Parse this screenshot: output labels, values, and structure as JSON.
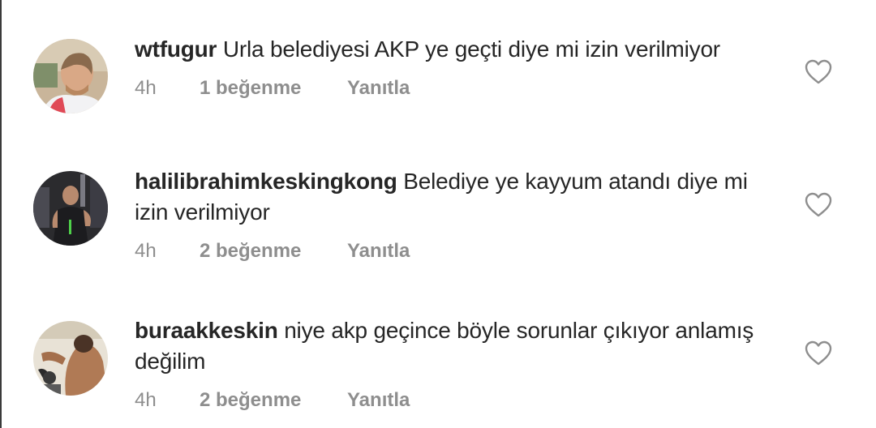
{
  "comments": [
    {
      "username": "wtfugur",
      "text": "Urla belediyesi AKP ye geçti diye mi izin verilmiyor",
      "time": "4h",
      "likes": "1 beğenme",
      "reply": "Yanıtla",
      "avatar_icon": "user-avatar-photo"
    },
    {
      "username": "halilibrahimkeskingkong",
      "text": "Belediye ye kayyum atandı diye mi izin verilmiyor",
      "time": "4h",
      "likes": "2 beğenme",
      "reply": "Yanıtla",
      "avatar_icon": "user-avatar-photo"
    },
    {
      "username": "buraakkeskin",
      "text": "niye akp geçince böyle sorunlar çıkıyor anlamış değilim",
      "time": "4h",
      "likes": "2 beğenme",
      "reply": "Yanıtla",
      "avatar_icon": "user-avatar-photo"
    }
  ],
  "icons": {
    "like": "heart-outline-icon"
  },
  "colors": {
    "text": "#262626",
    "meta": "#8e8e8e",
    "heart_stroke": "#8e8e8e"
  }
}
